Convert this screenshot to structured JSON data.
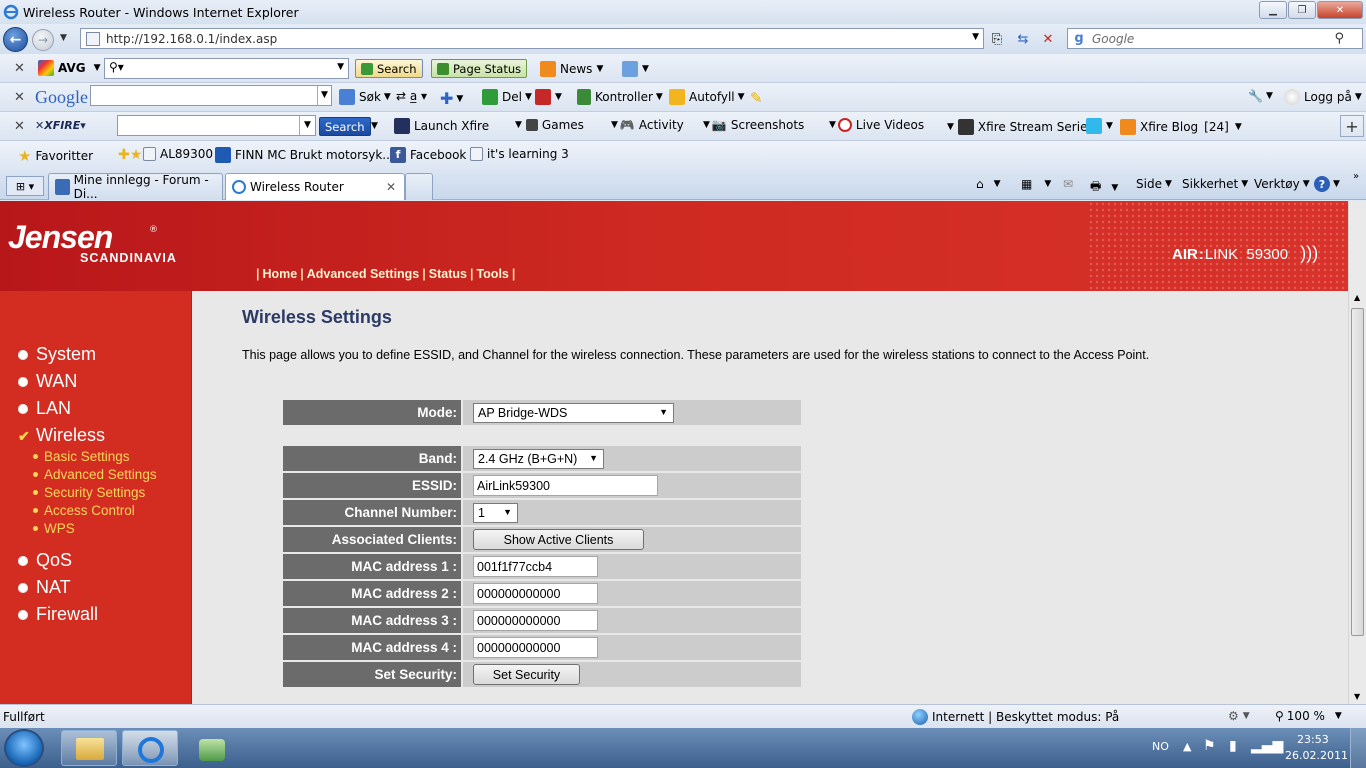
{
  "window": {
    "title": "Wireless Router - Windows Internet Explorer"
  },
  "address": {
    "url": "http://192.168.0.1/index.asp",
    "search_placeholder": "Google"
  },
  "toolbar_avg": {
    "brand": "AVG",
    "search_btn": "Search",
    "page_status": "Page Status",
    "news": "News"
  },
  "toolbar_google": {
    "brand": "Google",
    "search": "Søk",
    "del": "Del",
    "kontroller": "Kontroller",
    "autofyll": "Autofyll",
    "logg_pa": "Logg på"
  },
  "toolbar_xfire": {
    "brand": "XFIRE",
    "search_btn": "Search",
    "launch": "Launch Xfire",
    "games": "Games",
    "activity": "Activity",
    "screenshots": "Screenshots",
    "live_videos": "Live Videos",
    "stream_series": "Xfire Stream Series",
    "blog": "Xfire Blog",
    "blog_count": "[24]"
  },
  "favorites": {
    "label": "Favoritter",
    "items": [
      "AL89300",
      "FINN MC Brukt motorsyk...",
      "Facebook",
      "it's learning 3"
    ]
  },
  "tabs": {
    "tab1": "Mine innlegg - Forum - Di...",
    "tab2": "Wireless Router"
  },
  "command_bar": {
    "side": "Side",
    "sikkerhet": "Sikkerhet",
    "verktoy": "Verktøy"
  },
  "header": {
    "logo": "Jensen",
    "logo_sub": "SCANDINAVIA",
    "product_a": "AIR",
    "product_b": "LINK",
    "product_num": "59300",
    "nav": [
      "Home",
      "Advanced Settings",
      "Status",
      "Tools"
    ]
  },
  "sidebar": {
    "main_items": [
      "System",
      "WAN",
      "LAN",
      "Wireless",
      "QoS",
      "NAT",
      "Firewall"
    ],
    "sub_items": [
      "Basic Settings",
      "Advanced Settings",
      "Security Settings",
      "Access Control",
      "WPS"
    ]
  },
  "page": {
    "title": "Wireless Settings",
    "description": "This page allows you to define ESSID, and Channel for the wireless connection. These parameters are used for the wireless stations to connect to the Access Point."
  },
  "form": {
    "mode_label": "Mode:",
    "mode_value": "AP Bridge-WDS",
    "band_label": "Band:",
    "band_value": "2.4 GHz (B+G+N)",
    "essid_label": "ESSID:",
    "essid_value": "AirLink59300",
    "channel_label": "Channel Number:",
    "channel_value": "1",
    "clients_label": "Associated Clients:",
    "clients_button": "Show Active Clients",
    "mac1_label": "MAC address 1 :",
    "mac1_value": "001f1f77ccb4",
    "mac2_label": "MAC address 2 :",
    "mac2_value": "000000000000",
    "mac3_label": "MAC address 3 :",
    "mac3_value": "000000000000",
    "mac4_label": "MAC address 4 :",
    "mac4_value": "000000000000",
    "security_label": "Set Security:",
    "security_button": "Set Security"
  },
  "status": {
    "text": "Fullført",
    "zone": "Internett | Beskyttet modus: På",
    "zoom": "100 %"
  },
  "tray": {
    "lang": "NO",
    "time": "23:53",
    "date": "26.02.2011"
  }
}
